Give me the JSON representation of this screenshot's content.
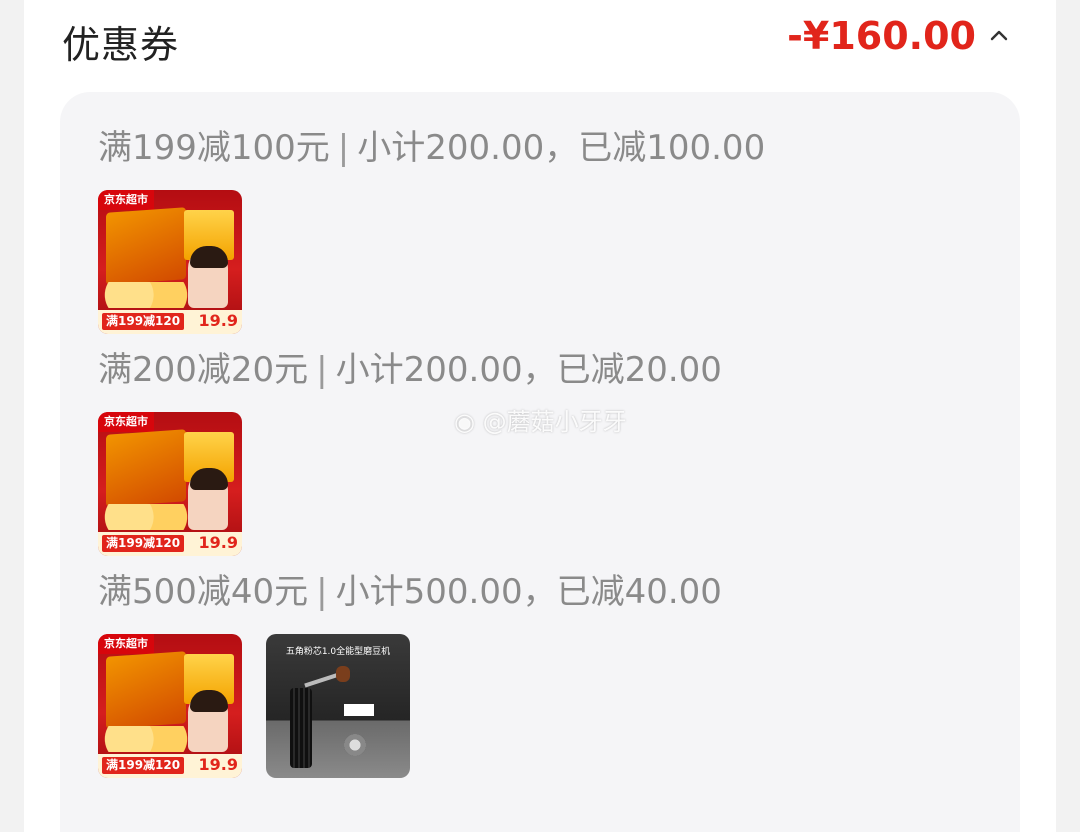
{
  "header": {
    "title": "优惠券",
    "total": "-¥160.00"
  },
  "groups": [
    {
      "rule": "满199减100元",
      "summary": "小计200.00，已减100.00",
      "products": [
        {
          "promo": "满199减120",
          "price": "19.9",
          "logo": "京东超市"
        }
      ]
    },
    {
      "rule": "满200减20元",
      "summary": "小计200.00，已减20.00",
      "products": [
        {
          "promo": "满199减120",
          "price": "19.9",
          "logo": "京东超市"
        }
      ]
    },
    {
      "rule": "满500减40元",
      "summary": "小计500.00，已减40.00",
      "products": [
        {
          "promo": "满199减120",
          "price": "19.9",
          "logo": "京东超市"
        },
        {
          "caption": "五角粉芯1.0全能型磨豆机"
        }
      ]
    }
  ],
  "watermark": "@蘑菇小牙牙",
  "icons": {
    "collapse": "chevron-up-icon",
    "weibo": "weibo-icon"
  },
  "colors": {
    "accent": "#e1251b",
    "muted_text": "#8a8a8a",
    "panel_bg": "#f5f5f7"
  }
}
